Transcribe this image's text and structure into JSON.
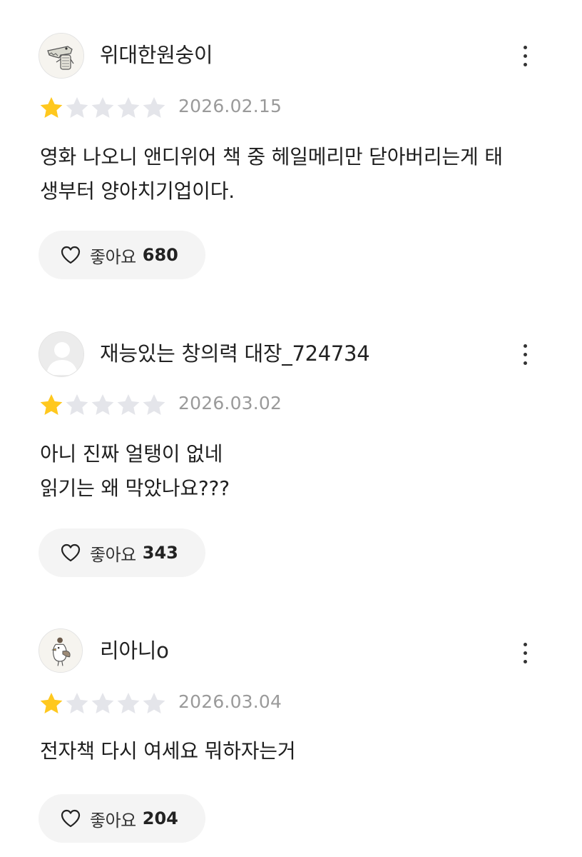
{
  "colors": {
    "star_filled": "#FFC81E",
    "star_empty": "#E4E5EA",
    "date_text": "#9A9A9A",
    "like_bg": "#F4F4F4"
  },
  "reviews": [
    {
      "username": "위대한원숭이",
      "avatar_icon": "crocodile-avatar-icon",
      "rating": 1,
      "rating_max": 5,
      "date": "2026.02.15",
      "body_lines": [
        "영화 나오니 앤디위어 책 중 헤일메리만 닫아버리는게 태",
        "생부터 양아치기업이다."
      ],
      "like_label": "좋아요",
      "like_count": "680"
    },
    {
      "username": "재능있는 창의력 대장_724734",
      "avatar_icon": "default-user-avatar-icon",
      "rating": 1,
      "rating_max": 5,
      "date": "2026.03.02",
      "body_lines": [
        "아니 진짜 얼탱이 없네",
        "읽기는 왜 막았나요???"
      ],
      "like_label": "좋아요",
      "like_count": "343"
    },
    {
      "username": "리아니o",
      "avatar_icon": "bird-avatar-icon",
      "rating": 1,
      "rating_max": 5,
      "date": "2026.03.04",
      "body_lines": [
        "전자책 다시 여세요 뭐하자는거"
      ],
      "like_label": "좋아요",
      "like_count": "204"
    }
  ]
}
